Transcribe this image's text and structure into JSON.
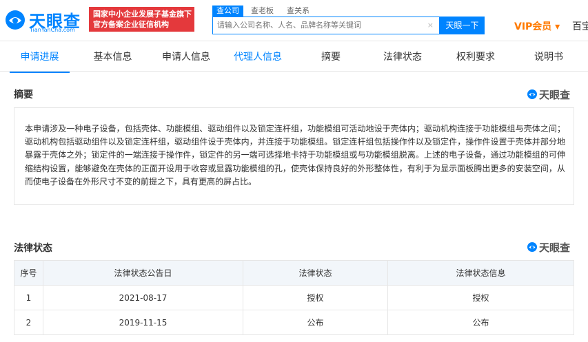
{
  "header": {
    "logo_text": "天眼查",
    "logo_url": "TianYanCha.com",
    "badge_line1": "国家中小企业发展子基金旗下",
    "badge_line2": "官方备案企业征信机构",
    "search_tabs": [
      "查公司",
      "查老板",
      "查关系"
    ],
    "search_placeholder": "请输入公司名称、人名、品牌名称等关键词",
    "search_clear": "×",
    "search_button": "天眼一下",
    "vip_label": "VIP会员 ▾",
    "baidu_label": "百宝"
  },
  "nav": {
    "items": [
      "申请进展",
      "基本信息",
      "申请人信息",
      "代理人信息",
      "摘要",
      "法律状态",
      "权利要求",
      "说明书"
    ]
  },
  "abstract": {
    "title": "摘要",
    "brand": "天眼查",
    "text": "本申请涉及一种电子设备，包括壳体、功能模组、驱动组件以及锁定连杆组，功能模组可活动地设于壳体内；驱动机构连接于功能模组与壳体之间；驱动机构包括驱动组件以及锁定连杆组，驱动组件设于壳体内，并连接于功能模组。锁定连杆组包括操作件以及锁定件，操作件设置于壳体并部分地暴露于壳体之外；锁定件的一端连接于操作件，锁定件的另一端可选择地卡持于功能模组或与功能模组脱离。上述的电子设备，通过功能模组的可伸缩结构设置，能够避免在壳体的正面开设用于收容或显露功能模组的孔，使壳体保持良好的外形整体性，有利于为显示面板腾出更多的安装空间，从而使电子设备在外形尺寸不变的前提之下，具有更高的屏占比。"
  },
  "legal_status": {
    "title": "法律状态",
    "brand": "天眼查",
    "columns": [
      "序号",
      "法律状态公告日",
      "法律状态",
      "法律状态信息"
    ],
    "rows": [
      [
        "1",
        "2021-08-17",
        "授权",
        "授权"
      ],
      [
        "2",
        "2019-11-15",
        "公布",
        "公布"
      ]
    ]
  },
  "colors": {
    "brand_blue": "#0084ff",
    "badge_red": "#e4393c",
    "vip_orange": "#ff7a00",
    "table_header_bg": "#f2f6fa"
  }
}
